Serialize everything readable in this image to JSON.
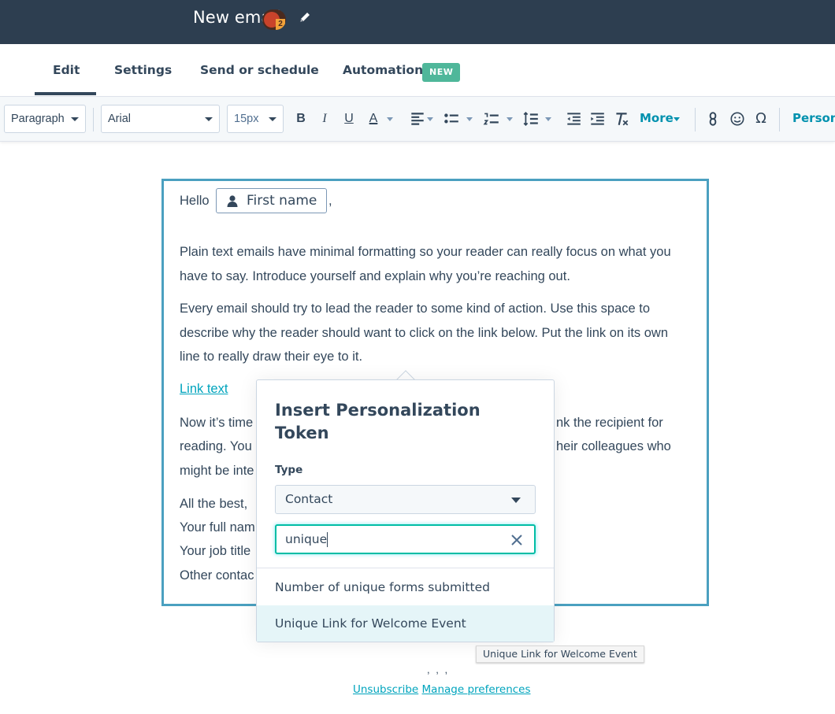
{
  "header": {
    "title": "New email"
  },
  "tabs": [
    {
      "label": "Edit"
    },
    {
      "label": "Settings"
    },
    {
      "label": "Send or schedule"
    },
    {
      "label": "Automation",
      "badge": "NEW"
    }
  ],
  "toolbar": {
    "paragraph": "Paragraph",
    "font": "Arial",
    "size": "15px",
    "more": "More",
    "personalize": "Person"
  },
  "email": {
    "greeting": "Hello",
    "token": "First name",
    "comma": ",",
    "para1": "Plain text emails have minimal formatting so your reader can really focus on what you have to say. Introduce yourself and explain why you’re reaching out.",
    "para2": "Every email should try to lead the reader to some kind of action. Use this space to describe why the reader should want to click on the link below. Put the link on its own line to really draw their eye to it.",
    "link": "Link text",
    "para3_l1a": "Now it’s time",
    "para3_l1b": "nk the recipient for",
    "para3_l2a": "reading. You",
    "para3_l2b": "heir colleagues who",
    "para3_l3": "might be inte",
    "sign1": "All the best,",
    "sign2": "Your full nam",
    "sign3": "Your job title",
    "sign4": "Other contac"
  },
  "popover": {
    "title": "Insert Personalization Token",
    "type_label": "Type",
    "type_value": "Contact",
    "search_value": "unique",
    "results": [
      "Number of unique forms submitted",
      "Unique Link for Welcome Event"
    ]
  },
  "tooltip": "Unique Link for Welcome Event",
  "footer": {
    "dots": ", , ,",
    "unsubscribe": "Unsubscribe",
    "manage": "Manage preferences"
  },
  "colors": {
    "header_bg": "#2d3e50",
    "accent": "#0091ae",
    "badge": "#4fb79a",
    "selected_row": "#e5f5f8"
  }
}
